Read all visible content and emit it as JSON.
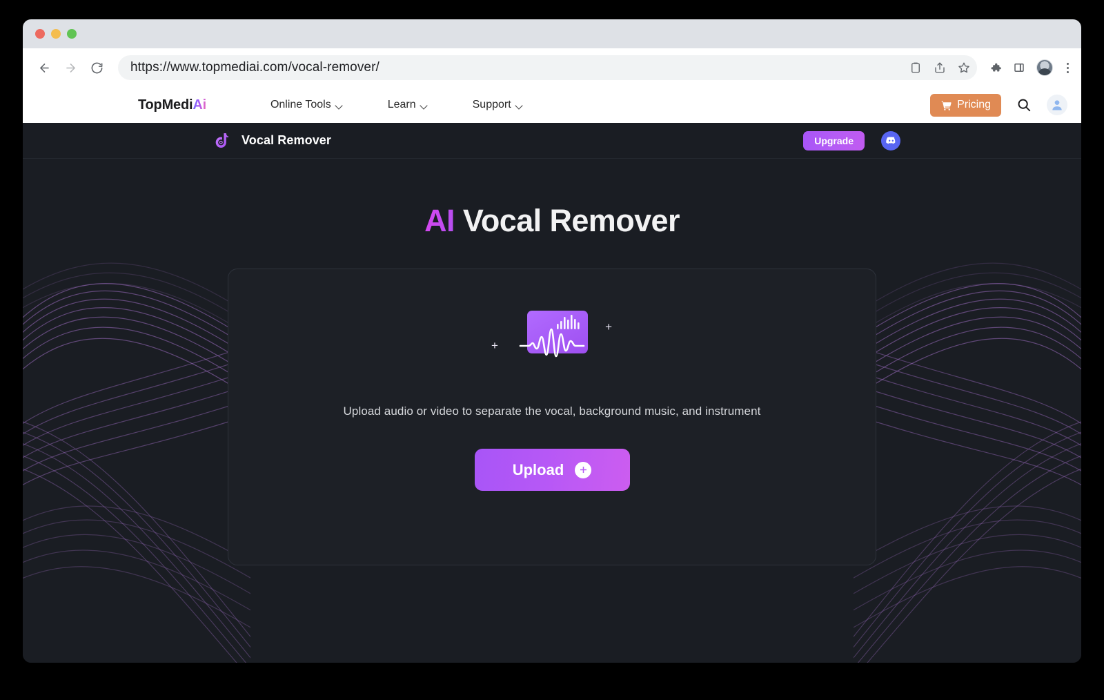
{
  "browser": {
    "url": "https://www.topmediai.com/vocal-remover/",
    "back_icon": "back-arrow-icon",
    "forward_icon": "forward-arrow-icon",
    "reload_icon": "reload-icon",
    "toolbar_icons": [
      "clipboard-icon",
      "share-icon",
      "bookmark-star-icon",
      "extensions-puzzle-icon",
      "side-panel-icon",
      "profile-avatar",
      "kebab-menu-icon"
    ],
    "window_controls": [
      "close-button",
      "minimize-button",
      "maximize-button"
    ]
  },
  "site_nav": {
    "brand_main": "TopMedi",
    "brand_accent": "Ai",
    "links": [
      {
        "label": "Online Tools"
      },
      {
        "label": "Learn"
      },
      {
        "label": "Support"
      }
    ],
    "pricing_label": "Pricing",
    "pricing_color": "#e08a54",
    "search_icon": "search-icon",
    "account_icon": "user-avatar-icon"
  },
  "app_bar": {
    "logo_icon": "vocal-remover-logo-icon",
    "title": "Vocal Remover",
    "upgrade_label": "Upgrade",
    "upgrade_color": "#a855f7",
    "discord_icon": "discord-icon",
    "discord_color": "#5865f2"
  },
  "hero": {
    "title_accent": "AI",
    "title_rest": "Vocal Remover",
    "accent_color": "#d946ef"
  },
  "upload_card": {
    "graphic_icon": "audio-folder-waveform-icon",
    "plus_left": "+",
    "plus_right": "+",
    "description": "Upload audio or video to separate the vocal, background music, and instrument",
    "button_label": "Upload",
    "button_icon": "plus-circle-icon",
    "button_color": "#b45cf5"
  },
  "background": {
    "page_color": "#1a1d23",
    "card_color": "#1d2026",
    "wave_color": "#8b5fa8",
    "decoration": "purple-flowing-waves"
  }
}
